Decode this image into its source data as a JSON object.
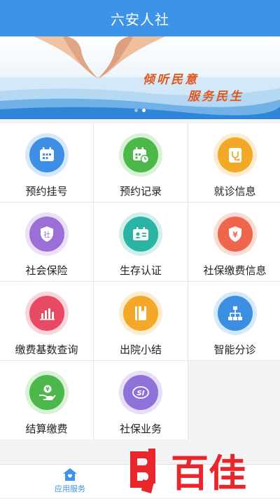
{
  "header": {
    "title": "六安人社"
  },
  "banner": {
    "slogan_line1": "倾听民意",
    "slogan_line2": "服务民生",
    "dot_count": 2,
    "active_dot": 1
  },
  "services": [
    {
      "label": "预约挂号",
      "icon": "calendar-icon",
      "color": "#3d8fe6",
      "ring": "#d6e8fb"
    },
    {
      "label": "预约记录",
      "icon": "calendar-record-icon",
      "color": "#4cb84a",
      "ring": "#d9f1d6"
    },
    {
      "label": "就诊信息",
      "icon": "stethoscope-icon",
      "color": "#f3a928",
      "ring": "#fcecd0"
    },
    {
      "label": "社会保险",
      "icon": "shield-icon",
      "color": "#9b6ed8",
      "ring": "#eae0f7"
    },
    {
      "label": "生存认证",
      "icon": "id-card-icon",
      "color": "#2bb3a3",
      "ring": "#d3efeb"
    },
    {
      "label": "社保缴费信息",
      "icon": "yen-shield-icon",
      "color": "#f0664c",
      "ring": "#fcdcd5"
    },
    {
      "label": "缴费基数查询",
      "icon": "bar-chart-icon",
      "color": "#e84a63",
      "ring": "#fad6dc"
    },
    {
      "label": "出院小结",
      "icon": "notebook-icon",
      "color": "#f4a829",
      "ring": "#fcecd0"
    },
    {
      "label": "智能分诊",
      "icon": "hierarchy-icon",
      "color": "#3a8fe4",
      "ring": "#d6e8fb"
    },
    {
      "label": "结算缴费",
      "icon": "hand-coin-icon",
      "color": "#4cb84a",
      "ring": "#d9f1d6"
    },
    {
      "label": "社保业务",
      "icon": "si-logo-icon",
      "color": "#8f72d9",
      "ring": "#e6dff7"
    }
  ],
  "nav": {
    "label": "应用服务",
    "icon": "home-icon",
    "color": "#3d93e8"
  },
  "watermark": {
    "text": "百佳"
  }
}
